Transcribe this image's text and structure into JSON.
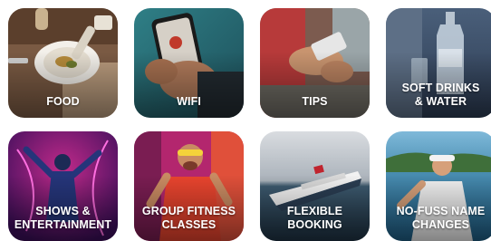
{
  "tiles": [
    {
      "label": "FOOD",
      "icon": "food-plate-photo"
    },
    {
      "label": "WIFI",
      "icon": "phone-wifi-photo"
    },
    {
      "label": "TIPS",
      "icon": "card-payment-photo"
    },
    {
      "label": "SOFT DRINKS\n& WATER",
      "icon": "water-bottle-photo"
    },
    {
      "label": "SHOWS &\nENTERTAINMENT",
      "icon": "performer-photo"
    },
    {
      "label": "GROUP FITNESS\nCLASSES",
      "icon": "fitness-instructor-photo"
    },
    {
      "label": "FLEXIBLE\nBOOKING",
      "icon": "cruise-ship-photo"
    },
    {
      "label": "NO-FUSS NAME\nCHANGES",
      "icon": "sailor-relaxing-photo"
    }
  ]
}
